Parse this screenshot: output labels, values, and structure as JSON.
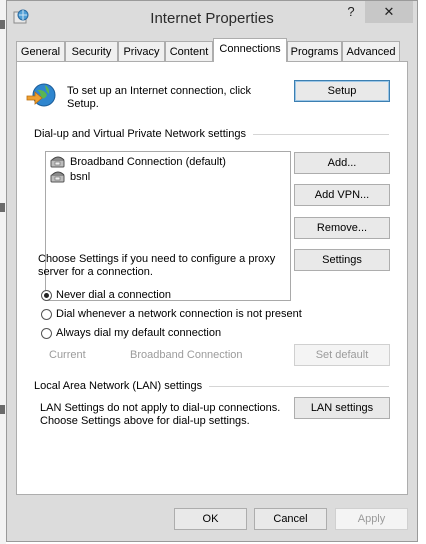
{
  "window": {
    "title": "Internet Properties",
    "help_glyph": "?",
    "close_glyph": "✕"
  },
  "tabs": [
    {
      "label": "General"
    },
    {
      "label": "Security"
    },
    {
      "label": "Privacy"
    },
    {
      "label": "Content"
    },
    {
      "label": "Connections",
      "active": true
    },
    {
      "label": "Programs"
    },
    {
      "label": "Advanced"
    }
  ],
  "setup": {
    "text_line1": "To set up an Internet connection, click",
    "text_line2": "Setup.",
    "button": "Setup"
  },
  "dialup": {
    "group_title": "Dial-up and Virtual Private Network settings",
    "connections": [
      {
        "name": "Broadband Connection (default)"
      },
      {
        "name": "bsnl"
      }
    ],
    "add_button": "Add...",
    "add_vpn_button": "Add VPN...",
    "remove_button": "Remove...",
    "settings_text_line1": "Choose Settings if you need to configure a proxy",
    "settings_text_line2": "server for a connection.",
    "settings_button": "Settings",
    "radio_options": [
      {
        "label": "Never dial a connection",
        "checked": true
      },
      {
        "label": "Dial whenever a network connection is not present",
        "checked": false
      },
      {
        "label": "Always dial my default connection",
        "checked": false
      }
    ],
    "current_label": "Current",
    "current_value": "Broadband Connection",
    "set_default_button": "Set default"
  },
  "lan": {
    "group_title": "Local Area Network (LAN) settings",
    "text_line1": "LAN Settings do not apply to dial-up connections.",
    "text_line2": "Choose Settings above for dial-up settings.",
    "button": "LAN settings"
  },
  "footer": {
    "ok": "OK",
    "cancel": "Cancel",
    "apply": "Apply"
  },
  "colors": {
    "window_bg": "#dcdcdc",
    "panel_bg": "#ffffff",
    "default_button_border": "#3c7fb1",
    "disabled_text": "#9b9b9b"
  }
}
